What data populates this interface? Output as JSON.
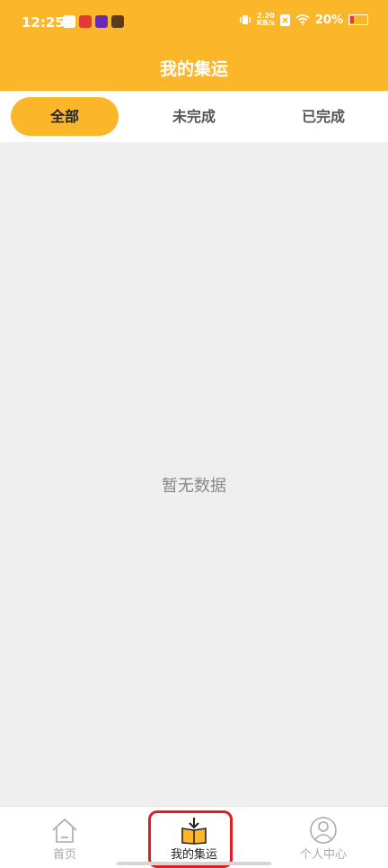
{
  "status_bar": {
    "time": "12:25",
    "net_speed_value": "2.20",
    "net_speed_unit": "KB/s",
    "battery_percent": "20%",
    "battery_level": 0.2,
    "app_icon_colors": [
      "#fbb62a",
      "#e53935",
      "#6a2bb5",
      "#5a3b1e"
    ]
  },
  "header": {
    "title": "我的集运"
  },
  "tabs": [
    {
      "label": "全部",
      "active": true
    },
    {
      "label": "未完成",
      "active": false
    },
    {
      "label": "已完成",
      "active": false
    }
  ],
  "main": {
    "empty_text": "暂无数据"
  },
  "bottom_nav": [
    {
      "label": "首页",
      "icon": "home-icon",
      "active": false
    },
    {
      "label": "我的集运",
      "icon": "package-icon",
      "active": true
    },
    {
      "label": "个人中心",
      "icon": "user-icon",
      "active": false
    }
  ],
  "colors": {
    "brand": "#fbb62a",
    "highlight": "#e11d24",
    "background": "#efefef"
  }
}
